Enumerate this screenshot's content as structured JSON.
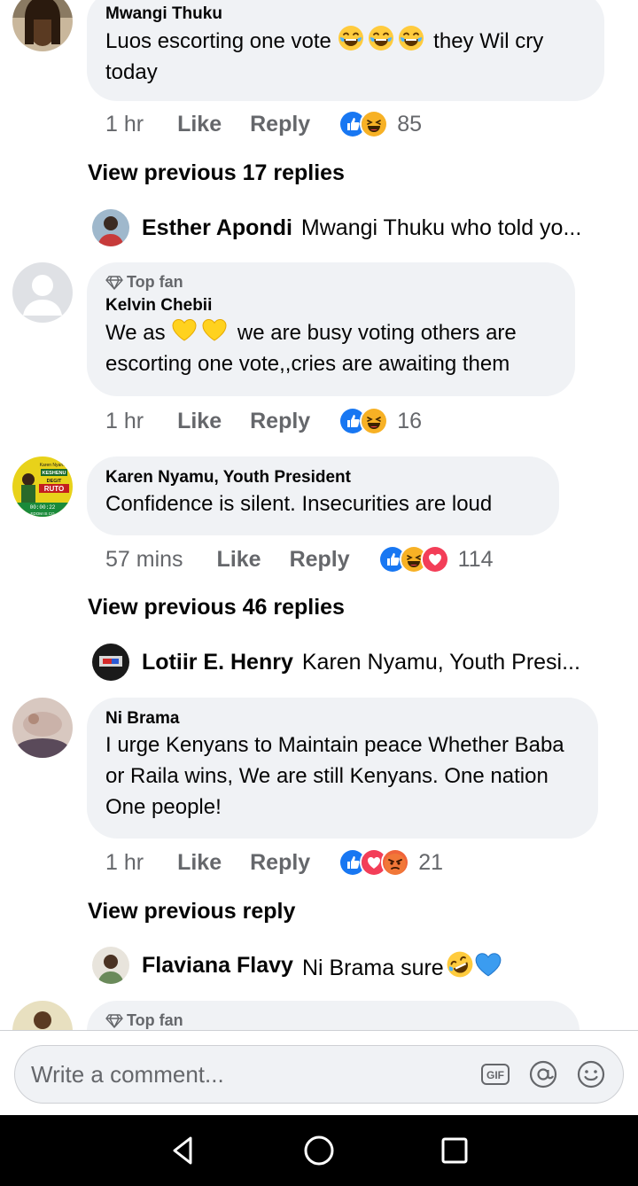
{
  "comments": [
    {
      "author": "Mwangi Thuku",
      "text_before": "Luos escorting one vote ",
      "text_after": " they Wil cry today",
      "time": "1 hr",
      "like_label": "Like",
      "reply_label": "Reply",
      "reaction_count": "85",
      "reactions": [
        "like-icon",
        "haha-icon"
      ]
    },
    {
      "top_fan_label": "Top fan",
      "author": "Kelvin Chebii",
      "text_before": "We as ",
      "text_after": " we are busy voting others are escorting one vote,,cries are awaiting them",
      "time": "1 hr",
      "like_label": "Like",
      "reply_label": "Reply",
      "reaction_count": "16",
      "reactions": [
        "like-icon",
        "haha-icon"
      ]
    },
    {
      "author": "Karen Nyamu, Youth President",
      "text": "Confidence is silent. Insecurities are loud",
      "time": "57 mins",
      "like_label": "Like",
      "reply_label": "Reply",
      "reaction_count": "114",
      "reactions": [
        "like-icon",
        "haha-icon",
        "love-icon"
      ]
    },
    {
      "author": "Ni Brama",
      "text": "I urge Kenyans to Maintain peace Whether Baba or Raila wins, We are still Kenyans. One nation One people!",
      "time": "1 hr",
      "like_label": "Like",
      "reply_label": "Reply",
      "reaction_count": "21",
      "reactions": [
        "like-icon",
        "love-icon",
        "angry-icon"
      ]
    },
    {
      "top_fan_label": "Top fan"
    }
  ],
  "view_previous": [
    "View previous 17 replies",
    "View previous 46 replies",
    "View previous reply"
  ],
  "reply_previews": [
    {
      "author": "Esther Apondi",
      "text": "Mwangi Thuku who told yo..."
    },
    {
      "author": "Lotiir E. Henry",
      "text": "Karen Nyamu, Youth Presi..."
    },
    {
      "author": "Flaviana Flavy",
      "text": "Ni Brama sure"
    }
  ],
  "composer": {
    "placeholder": "Write a comment..."
  },
  "colors": {
    "bubble": "#f0f2f5",
    "secondary_text": "#65676b",
    "like_blue": "#1877f2",
    "love_red": "#f33e58",
    "haha_yellow": "#f7b125"
  },
  "avatar_badge": {
    "small_top": "Karen Nyamu",
    "name1": "KESHENU",
    "name2": "DEGIT",
    "name3": "RUTO",
    "clock": "00:00:22",
    "footer": "EDOM IS CO"
  }
}
